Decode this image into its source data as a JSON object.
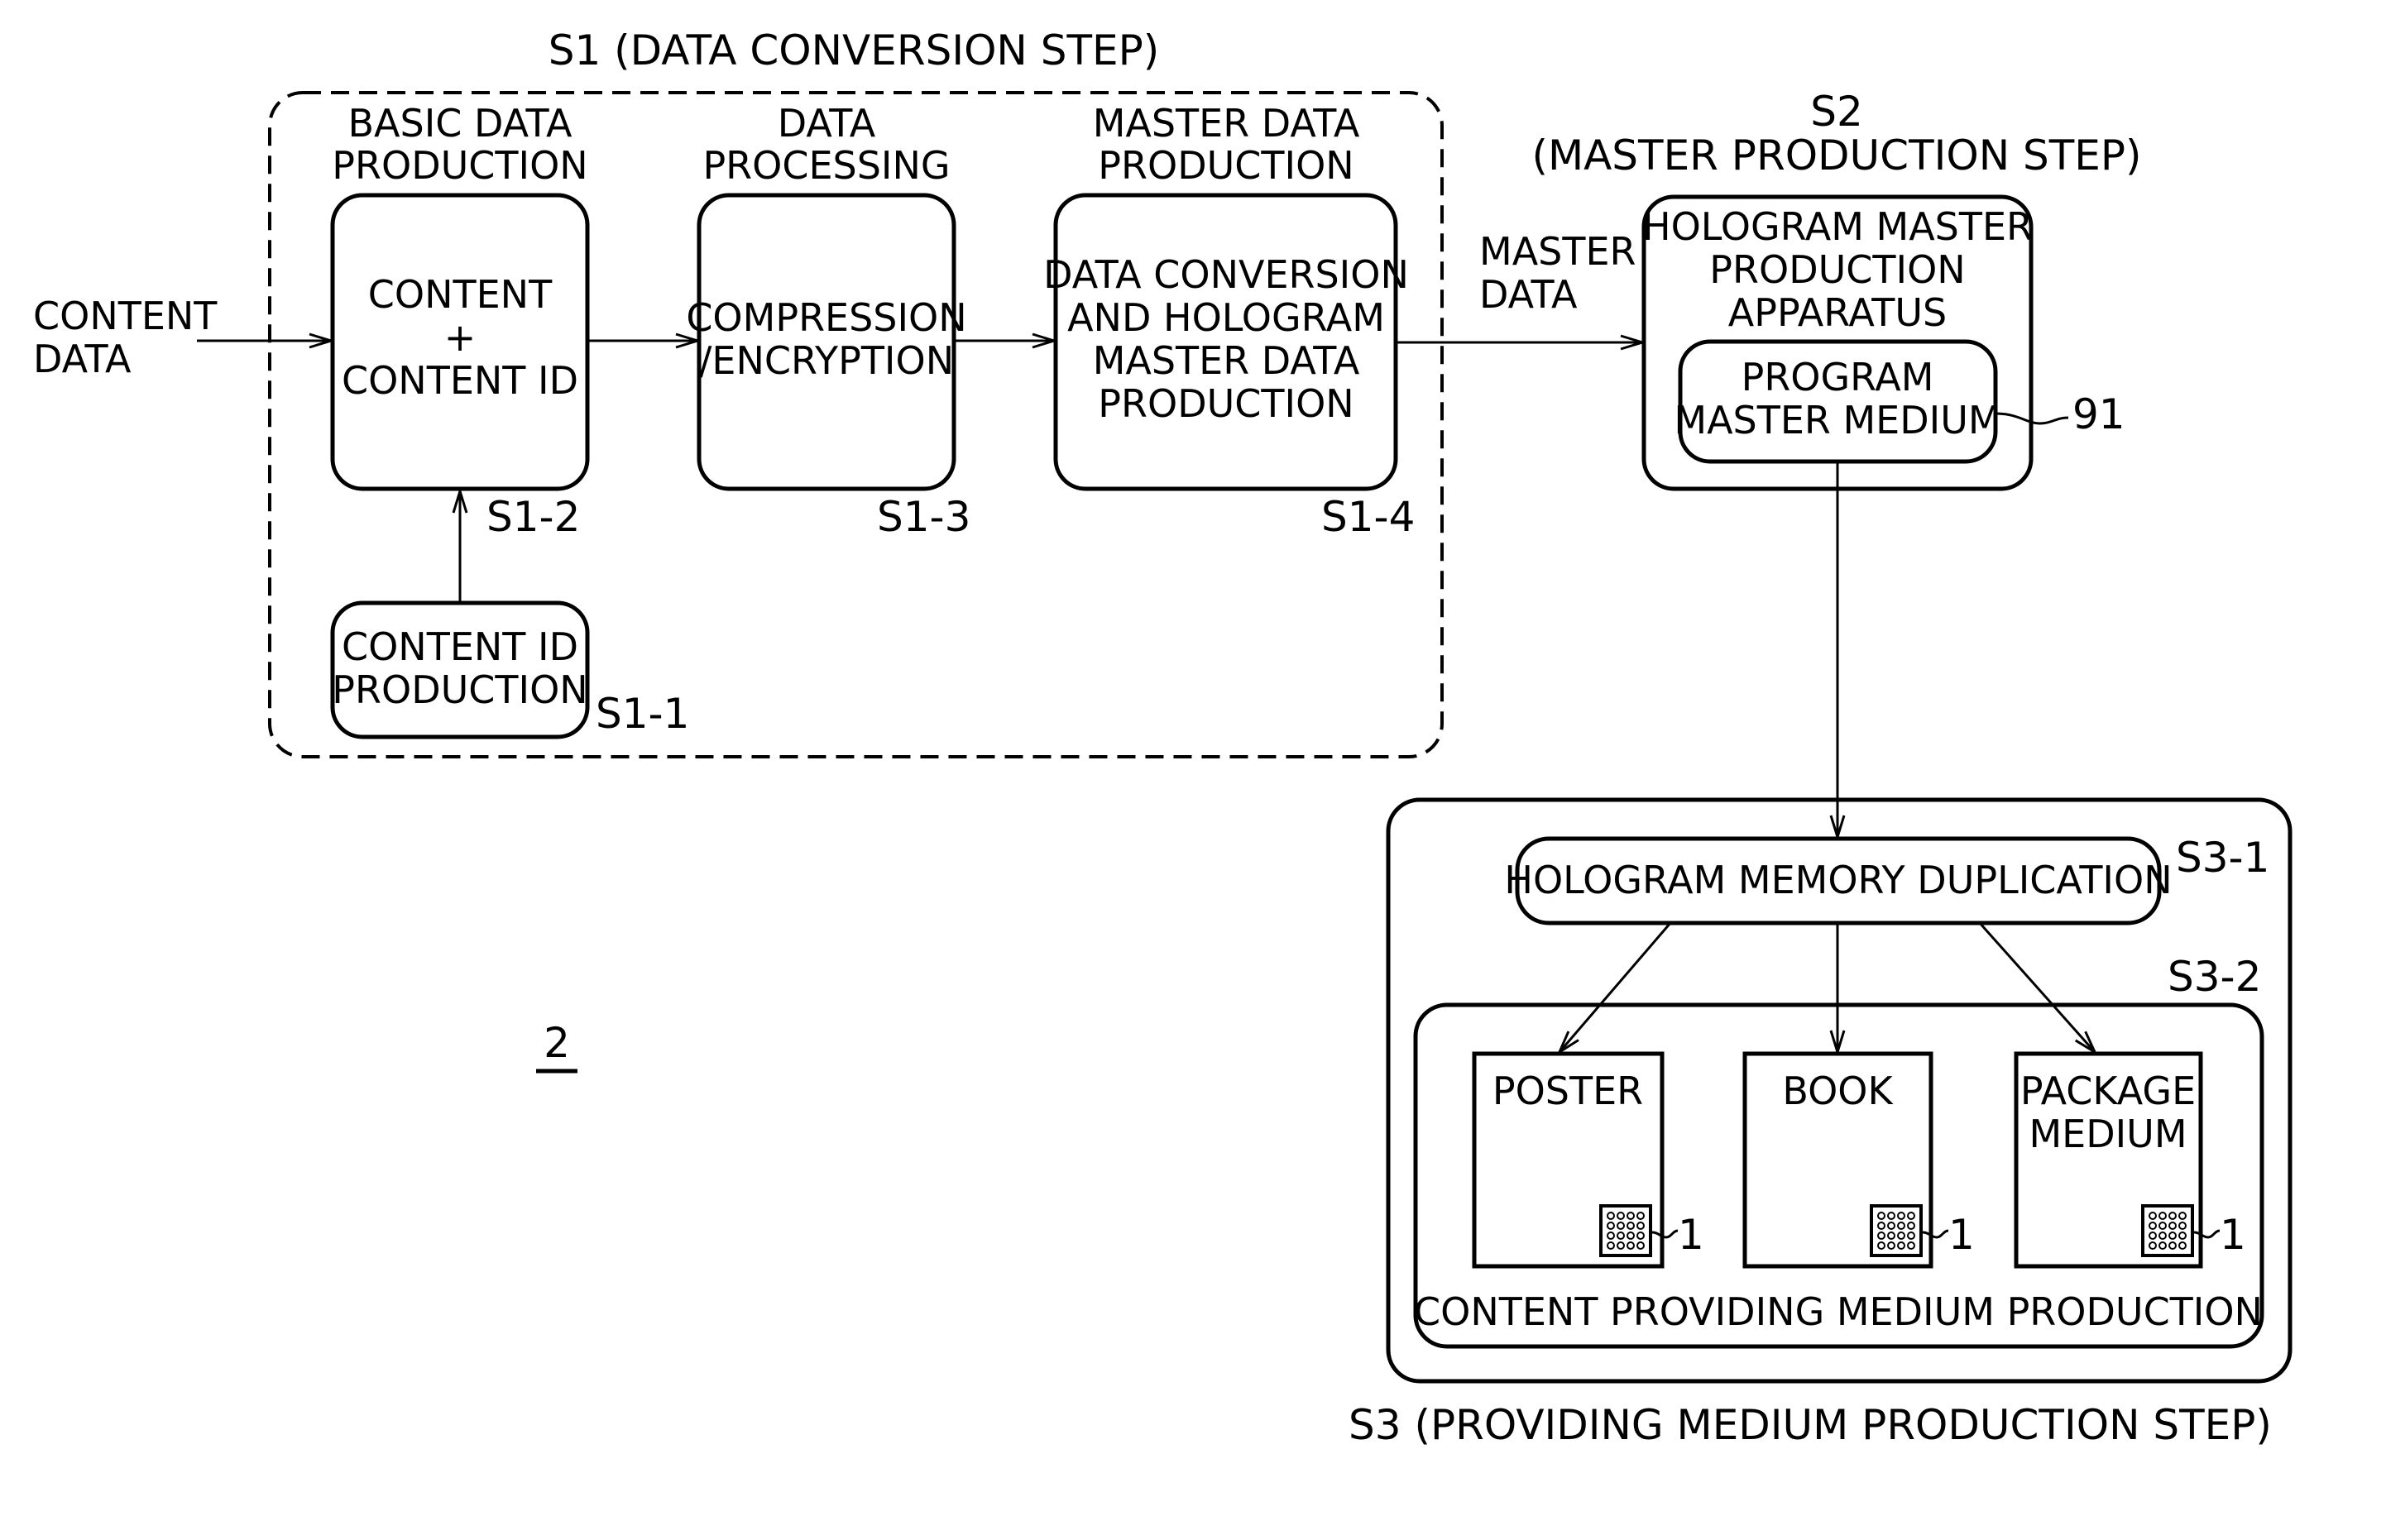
{
  "figure_ref": "2",
  "input": {
    "label_lines": [
      "CONTENT",
      "DATA"
    ]
  },
  "s1": {
    "title": "S1 (DATA CONVERSION STEP)",
    "steps": [
      {
        "id": "S1-1",
        "box_lines": [
          "CONTENT ID",
          "PRODUCTION"
        ],
        "header_lines": []
      },
      {
        "id": "S1-2",
        "header_lines": [
          "BASIC DATA",
          "PRODUCTION"
        ],
        "box_lines": [
          "CONTENT",
          "+",
          "CONTENT ID"
        ]
      },
      {
        "id": "S1-3",
        "header_lines": [
          "DATA",
          "PROCESSING"
        ],
        "box_lines": [
          "COMPRESSION",
          "/ENCRYPTION"
        ]
      },
      {
        "id": "S1-4",
        "header_lines": [
          "MASTER DATA",
          "PRODUCTION"
        ],
        "box_lines": [
          "DATA CONVERSION",
          "AND HOLOGRAM",
          "MASTER DATA",
          "PRODUCTION"
        ]
      }
    ]
  },
  "connector_master_data": {
    "label_lines": [
      "MASTER",
      "DATA"
    ]
  },
  "s2": {
    "title_lines": [
      "S2",
      "(MASTER PRODUCTION STEP)"
    ],
    "apparatus_lines": [
      "HOLOGRAM MASTER",
      "PRODUCTION",
      "APPARATUS"
    ],
    "medium_lines": [
      "PROGRAM",
      "MASTER MEDIUM"
    ],
    "medium_ref": "91"
  },
  "s3": {
    "title": "S3 (PROVIDING MEDIUM PRODUCTION STEP)",
    "duplication": {
      "id": "S3-1",
      "label": "HOLOGRAM MEMORY DUPLICATION"
    },
    "production": {
      "id": "S3-2",
      "label": "CONTENT PROVIDING MEDIUM PRODUCTION",
      "media": [
        {
          "label_lines": [
            "POSTER"
          ],
          "hologram_ref": "1"
        },
        {
          "label_lines": [
            "BOOK"
          ],
          "hologram_ref": "1"
        },
        {
          "label_lines": [
            "PACKAGE",
            "MEDIUM"
          ],
          "hologram_ref": "1"
        }
      ]
    }
  },
  "icons": {
    "hologram_memory": "hologram-memory-chip-icon (4x4 dot grid)"
  }
}
